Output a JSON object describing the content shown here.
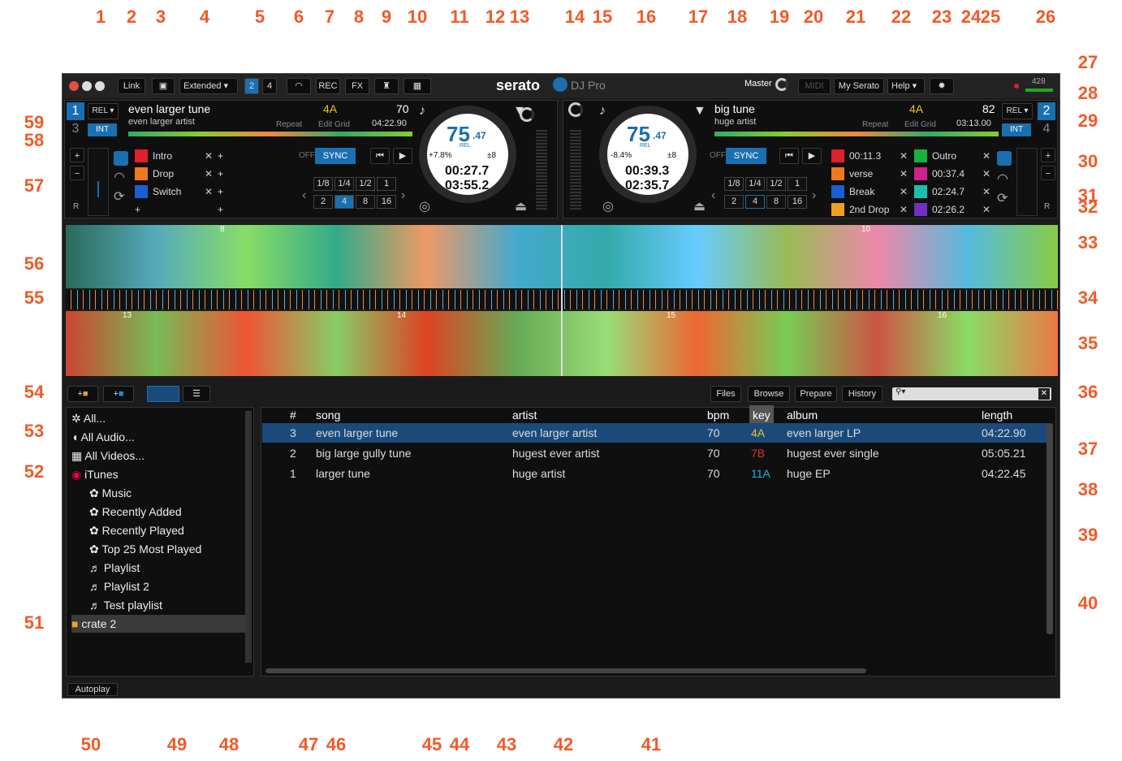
{
  "app": {
    "brand": "serato",
    "product": "DJ Pro"
  },
  "topbar": {
    "link": "Link",
    "layout": "Extended",
    "deck_count": [
      "2",
      "4"
    ],
    "rec": "REC",
    "fx": "FX",
    "master": "Master",
    "midi": "MIDI",
    "my_serato": "My Serato",
    "help": "Help",
    "cpu": "428"
  },
  "deck1": {
    "number": "1",
    "alt_number": "3",
    "mode": "REL",
    "int": "INT",
    "title": "even larger tune",
    "artist": "even larger artist",
    "key": "4A",
    "bpm": "70",
    "repeat": "Repeat",
    "edit_grid": "Edit Grid",
    "total": "04:22.90",
    "tempo": "75",
    "tempo_dec": ".47",
    "rel": "REL",
    "pitch": "+7.8%",
    "range": "±8",
    "elapsed": "00:27.7",
    "remain": "03:55.2",
    "off": "OFF",
    "sync": "SYNC",
    "cues": [
      {
        "label": "Intro",
        "color": "#e0202a"
      },
      {
        "label": "Drop",
        "color": "#f07820"
      },
      {
        "label": "Switch",
        "color": "#1a5fcf"
      }
    ],
    "loops": [
      "1/8",
      "1/4",
      "1/2",
      "1",
      "2",
      "4",
      "8",
      "16"
    ]
  },
  "deck2": {
    "number": "2",
    "alt_number": "4",
    "mode": "REL",
    "int": "INT",
    "title": "big tune",
    "artist": "huge artist",
    "key": "4A",
    "bpm": "82",
    "repeat": "Repeat",
    "edit_grid": "Edit Grid",
    "total": "03:13.00",
    "tempo": "75",
    "tempo_dec": ".47",
    "rel": "REL",
    "pitch": "-8.4%",
    "range": "±8",
    "elapsed": "00:39.3",
    "remain": "02:35.7",
    "off": "OFF",
    "sync": "SYNC",
    "cues_left": [
      {
        "label": "00:11.3",
        "color": "#e0202a"
      },
      {
        "label": "verse",
        "color": "#f07820"
      },
      {
        "label": "Break",
        "color": "#1a5fcf"
      },
      {
        "label": "2nd Drop",
        "color": "#f0a020"
      }
    ],
    "cues_right": [
      {
        "label": "Outro",
        "color": "#18b040"
      },
      {
        "label": "00:37.4",
        "color": "#d02090"
      },
      {
        "label": "02:24.7",
        "color": "#18c0b0"
      },
      {
        "label": "02:26.2",
        "color": "#7030c0"
      }
    ],
    "loops": [
      "1/8",
      "1/4",
      "1/2",
      "1",
      "2",
      "4",
      "8",
      "16"
    ]
  },
  "waveform": {
    "beats_top": [
      "8",
      "10"
    ],
    "beats_bottom": [
      "13",
      "14",
      "15",
      "16"
    ]
  },
  "library": {
    "tabs": [
      "Files",
      "Browse",
      "Prepare",
      "History"
    ],
    "columns": [
      "#",
      "song",
      "artist",
      "bpm",
      "key",
      "album",
      "length"
    ],
    "rows": [
      {
        "n": "3",
        "song": "even larger tune",
        "artist": "even larger artist",
        "bpm": "70",
        "key": "4A",
        "key_color": "#f0c020",
        "album": "even larger LP",
        "length": "04:22.90"
      },
      {
        "n": "2",
        "song": "big large gully tune",
        "artist": "hugest ever artist",
        "bpm": "70",
        "key": "7B",
        "key_color": "#e0302a",
        "album": "hugest ever single",
        "length": "05:05.21"
      },
      {
        "n": "1",
        "song": "larger tune",
        "artist": "huge artist",
        "bpm": "70",
        "key": "11A",
        "key_color": "#20b0e0",
        "album": "huge EP",
        "length": "04:22.45"
      }
    ]
  },
  "sidebar": {
    "items": [
      "All...",
      "All Audio...",
      "All Videos...",
      "iTunes",
      "Music",
      "Recently Added",
      "Recently Played",
      "Top 25 Most Played",
      "Playlist",
      "Playlist 2",
      "Test playlist",
      "crate 2"
    ]
  },
  "autoplay": "Autoplay",
  "callouts": [
    "1",
    "2",
    "3",
    "4",
    "5",
    "6",
    "7",
    "8",
    "9",
    "10",
    "11",
    "12",
    "13",
    "14",
    "15",
    "16",
    "17",
    "18",
    "19",
    "20",
    "21",
    "22",
    "23",
    "24",
    "25",
    "26",
    "27",
    "28",
    "29",
    "30",
    "31",
    "32",
    "33",
    "34",
    "35",
    "36",
    "37",
    "38",
    "39",
    "40",
    "41",
    "42",
    "43",
    "44",
    "45",
    "46",
    "47",
    "48",
    "49",
    "50",
    "51",
    "52",
    "53",
    "54",
    "55",
    "56",
    "57",
    "58",
    "59"
  ],
  "colors": {
    "accent": "#f05a28",
    "serato_blue": "#1a6fb0",
    "highlight_row": "#1a4a7a"
  }
}
